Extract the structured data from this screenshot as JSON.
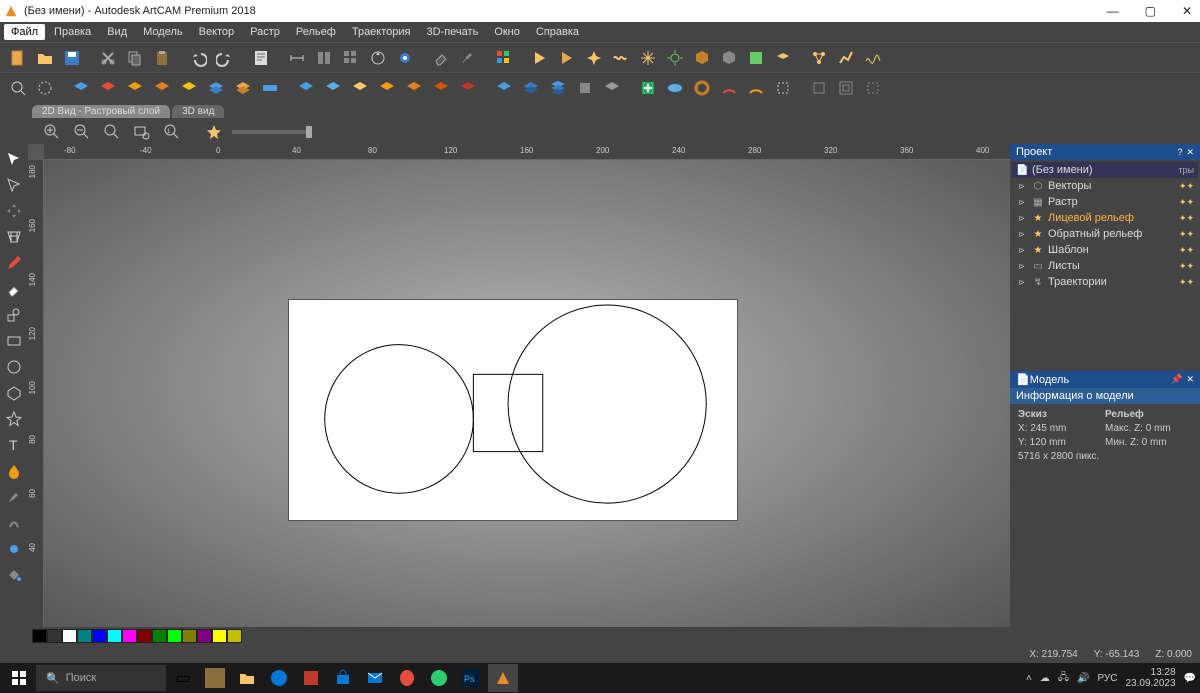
{
  "title": "(Без имени) - Autodesk ArtCAM Premium 2018",
  "menus": [
    "Файл",
    "Правка",
    "Вид",
    "Модель",
    "Вектор",
    "Растр",
    "Рельеф",
    "Траектория",
    "3D-печать",
    "Окно",
    "Справка"
  ],
  "active_menu": 0,
  "tabs": {
    "t1": "2D Вид - Растровый слой",
    "t2": "3D вид"
  },
  "project_panel": {
    "title": "Проект",
    "root": "(Без имени)",
    "items": [
      {
        "icon": "vec",
        "label": "Векторы"
      },
      {
        "icon": "ras",
        "label": "Растр"
      },
      {
        "icon": "star",
        "label": "Лицевой рельеф",
        "hl": true
      },
      {
        "icon": "star",
        "label": "Обратный рельеф"
      },
      {
        "icon": "star",
        "label": "Шаблон"
      },
      {
        "icon": "sheet",
        "label": "Листы"
      },
      {
        "icon": "path",
        "label": "Траектории"
      }
    ],
    "col_hdr": "тры"
  },
  "model_panel": {
    "title": "Модель",
    "subtitle": "Информация о модели",
    "sketch_hdr": "Эскиз",
    "relief_hdr": "Рельеф",
    "x": "X: 245 mm",
    "y": "Y: 120 mm",
    "px": "5716 x 2800 пикс.",
    "max_z": "Макс. Z: 0 mm",
    "min_z": "Мин. Z: 0 mm"
  },
  "ruler_h": [
    -80,
    -40,
    0,
    40,
    80,
    120,
    160,
    200,
    240,
    280,
    320,
    360,
    400
  ],
  "ruler_v": [
    180,
    160,
    140,
    120,
    100,
    80,
    60,
    40
  ],
  "colors": [
    "#000000",
    "#333333",
    "#ffffff",
    "#008080",
    "#0000ff",
    "#00ffff",
    "#ff00ff",
    "#800000",
    "#008000",
    "#00ff00",
    "#808000",
    "#800080",
    "#ffff00",
    "#c0c000"
  ],
  "status": {
    "x": "X: 219.754",
    "y": "Y: -65.143",
    "z": "Z: 0.000"
  },
  "taskbar": {
    "search": "Поиск",
    "lang": "РУС",
    "time": "13:28",
    "date": "23.09.2023"
  }
}
